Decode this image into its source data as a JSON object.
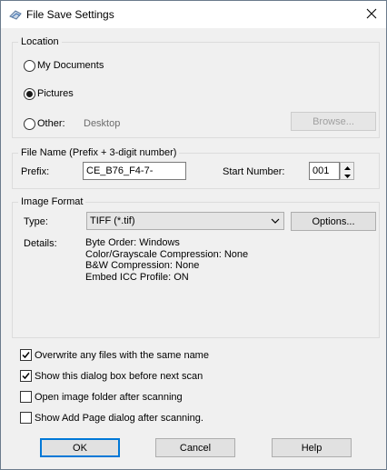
{
  "window": {
    "title": "File Save Settings",
    "title_icon": "scanner-icon",
    "close_icon": "close-icon"
  },
  "location": {
    "legend": "Location",
    "options": [
      {
        "label": "My Documents",
        "selected": false
      },
      {
        "label": "Pictures",
        "selected": true
      },
      {
        "label": "Other:",
        "selected": false
      }
    ],
    "other_path": "Desktop",
    "browse_label": "Browse..."
  },
  "file_name": {
    "legend": "File Name (Prefix + 3-digit number)",
    "prefix_label": "Prefix:",
    "prefix_value": "CE_B76_F4-7-",
    "start_label": "Start Number:",
    "start_value": "001"
  },
  "image_format": {
    "legend": "Image Format",
    "type_label": "Type:",
    "type_value": "TIFF (*.tif)",
    "options_label": "Options...",
    "details_label": "Details:",
    "details": [
      "Byte Order: Windows",
      "Color/Grayscale Compression: None",
      "B&W Compression: None",
      "Embed ICC Profile: ON"
    ]
  },
  "checkboxes": [
    {
      "label": "Overwrite any files with the same name",
      "checked": true
    },
    {
      "label": "Show this dialog box before next scan",
      "checked": true
    },
    {
      "label": "Open image folder after scanning",
      "checked": false
    },
    {
      "label": "Show Add Page dialog after scanning.",
      "checked": false
    }
  ],
  "buttons": {
    "ok": "OK",
    "cancel": "Cancel",
    "help": "Help"
  },
  "colors": {
    "window_bg": "#f0f0f0",
    "accent": "#0078d7",
    "disabled_text": "#a0a0a0"
  }
}
